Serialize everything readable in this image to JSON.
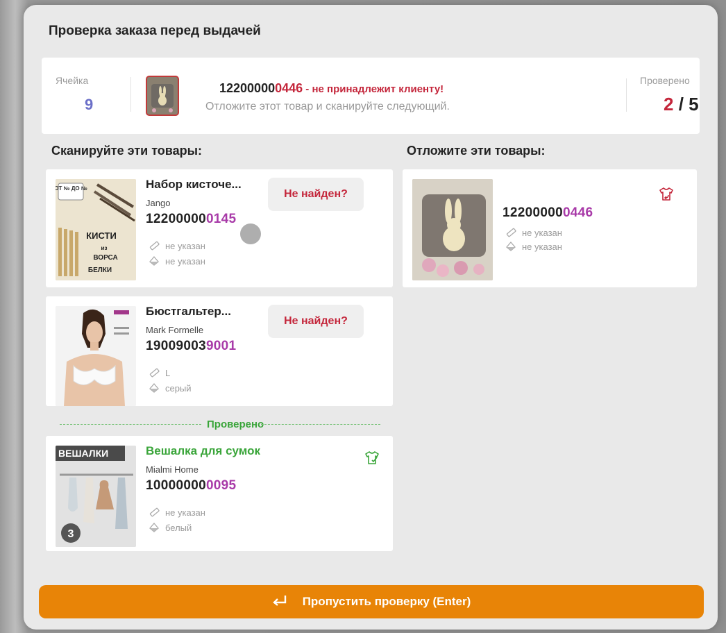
{
  "modal": {
    "title": "Проверка заказа перед выдачей"
  },
  "status": {
    "cell_label": "Ячейка",
    "cell_value": "9",
    "scanned_code_prefix": "12200000",
    "scanned_code_suffix": "0446",
    "message_red": " - не принадлежит клиенту!",
    "hint": "Отложите этот товар и сканируйте следующий.",
    "checked_label": "Проверено",
    "checked_done": "2",
    "checked_total": " / 5"
  },
  "scan_column": {
    "title": "Сканируйте эти товары:"
  },
  "setaside_column": {
    "title": "Отложите эти товары:"
  },
  "scan_items": [
    {
      "name": "Набор кисточе...",
      "brand": "Jango",
      "code_prefix": "12200000",
      "code_suffix": "0145",
      "size": "не указан",
      "color": "не указан",
      "button": "Не найден?",
      "image_text": [
        "ОТ № ДО №",
        "КИСТИ",
        "из",
        "ВОРСА",
        "БЕЛКИ"
      ]
    },
    {
      "name": "Бюстгальтер...",
      "brand": "Mark Formelle",
      "code_prefix": "19009003",
      "code_suffix": "9001",
      "size": "L",
      "color": "серый",
      "button": "Не найден?"
    }
  ],
  "checked_separator": "Проверено",
  "checked_items": [
    {
      "name": "Вешалка для сумок",
      "brand": "Mialmi Home",
      "code_prefix": "10000000",
      "code_suffix": "0095",
      "size": "не указан",
      "color": "белый",
      "image_text": [
        "ВЕШАЛКИ",
        "3"
      ]
    }
  ],
  "setaside_items": [
    {
      "code_prefix": "12200000",
      "code_suffix": "0446",
      "size": "не указан",
      "color": "не указан"
    }
  ],
  "footer": {
    "skip_button": "Пропустить проверку (Enter)"
  },
  "icons": {
    "ruler": "ruler-icon",
    "drop": "color-drop-icon",
    "shirt_return": "shirt-return-icon",
    "shirt_check": "shirt-check-icon",
    "enter": "enter-key-icon"
  },
  "colors": {
    "accent_orange": "#e88407",
    "error_red": "#c4263b",
    "success_green": "#3aa53a",
    "code_purple": "#a83aa8",
    "cell_blue": "#6b6fc8"
  }
}
